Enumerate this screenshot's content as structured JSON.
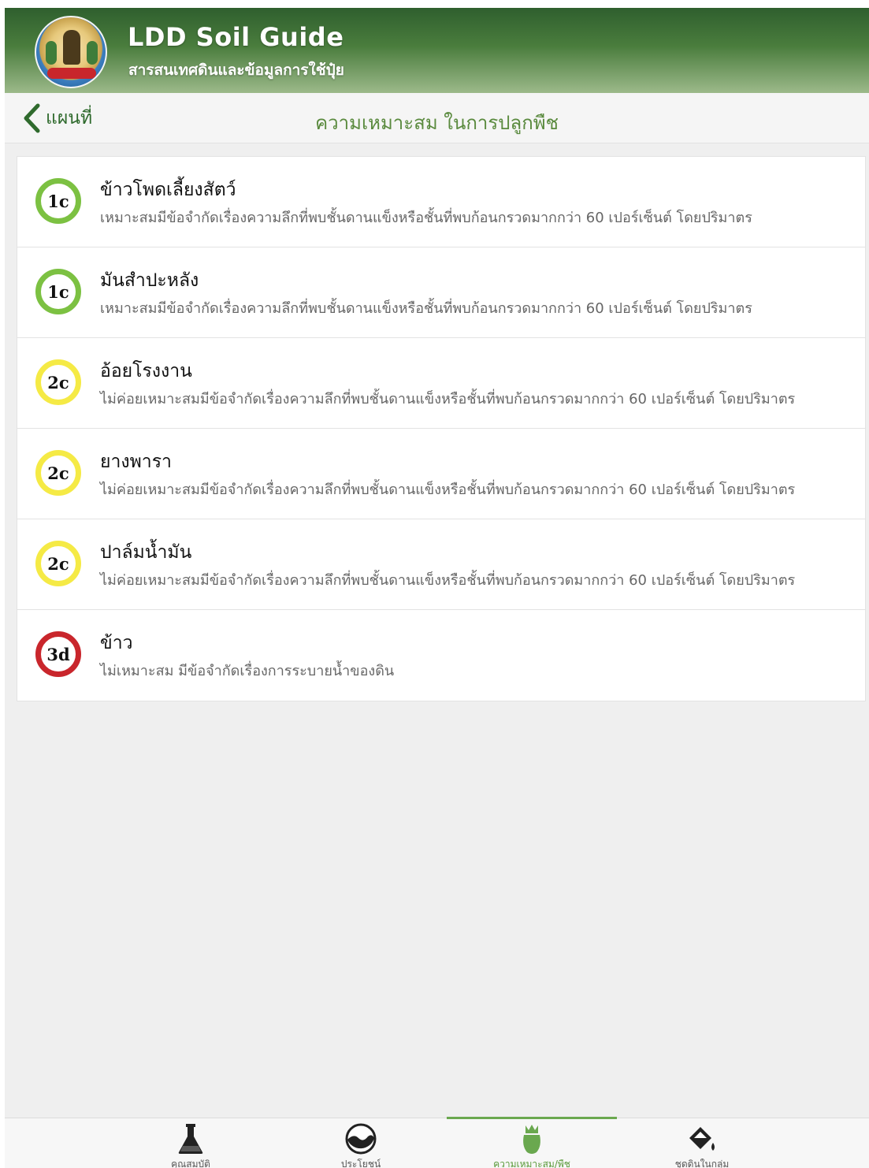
{
  "header": {
    "title": "LDD Soil Guide",
    "subtitle": "สารสนเทศดินและข้อมูลการใช้ปุ๋ย"
  },
  "navbar": {
    "back_label": "แผนที่",
    "title": "ความเหมาะสม ในการปลูกพืช"
  },
  "crops": [
    {
      "code": "1c",
      "level": "high",
      "color": "#7cc142",
      "name": "ข้าวโพดเลี้ยงสัตว์",
      "description": "เหมาะสมมีข้อจำกัดเรื่องความลึกที่พบชั้นดานแข็งหรือชั้นที่พบก้อนกรวดมากกว่า  60 เปอร์เซ็นต์ โดยปริมาตร"
    },
    {
      "code": "1c",
      "level": "high",
      "color": "#7cc142",
      "name": "มันสำปะหลัง",
      "description": "เหมาะสมมีข้อจำกัดเรื่องความลึกที่พบชั้นดานแข็งหรือชั้นที่พบก้อนกรวดมากกว่า  60 เปอร์เซ็นต์ โดยปริมาตร"
    },
    {
      "code": "2c",
      "level": "medium",
      "color": "#f5ea45",
      "name": "อ้อยโรงงาน",
      "description": "ไม่ค่อยเหมาะสมมีข้อจำกัดเรื่องความลึกที่พบชั้นดานแข็งหรือชั้นที่พบก้อนกรวดมากกว่า  60 เปอร์เซ็นต์ โดยปริมาตร"
    },
    {
      "code": "2c",
      "level": "medium",
      "color": "#f5ea45",
      "name": "ยางพารา",
      "description": "ไม่ค่อยเหมาะสมมีข้อจำกัดเรื่องความลึกที่พบชั้นดานแข็งหรือชั้นที่พบก้อนกรวดมากกว่า  60 เปอร์เซ็นต์ โดยปริมาตร"
    },
    {
      "code": "2c",
      "level": "medium",
      "color": "#f5ea45",
      "name": "ปาล์มน้ำมัน",
      "description": "ไม่ค่อยเหมาะสมมีข้อจำกัดเรื่องความลึกที่พบชั้นดานแข็งหรือชั้นที่พบก้อนกรวดมากกว่า  60 เปอร์เซ็นต์ โดยปริมาตร"
    },
    {
      "code": "3d",
      "level": "low",
      "color": "#c9262c",
      "name": "ข้าว",
      "description": "ไม่เหมาะสม มีข้อจำกัดเรื่องการระบายน้ำของดิน"
    }
  ],
  "tabs": [
    {
      "label": "คุณสมบัติ",
      "icon": "flask-icon",
      "active": false
    },
    {
      "label": "ประโยชน์",
      "icon": "soil-bowl-icon",
      "active": false
    },
    {
      "label": "ความเหมาะสม/พืช",
      "icon": "plant-icon",
      "active": true
    },
    {
      "label": "ชุดดินในกลุ่ม",
      "icon": "paint-bucket-icon",
      "active": false
    }
  ],
  "colors": {
    "header_dark": "#2f5f2e",
    "accent_green": "#5a8a3e",
    "active_tab": "#5a9a3a"
  }
}
